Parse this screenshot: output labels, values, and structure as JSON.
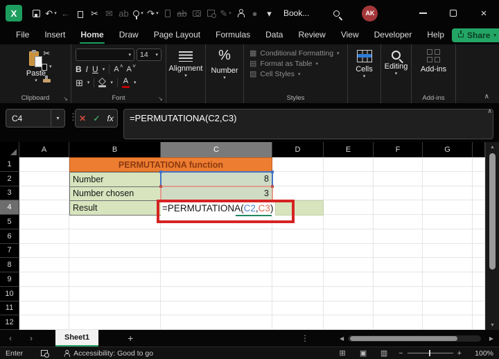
{
  "title_bar": {
    "workbook_title": "Book...",
    "avatar_initials": "AK",
    "qat_icons": [
      {
        "name": "save-icon",
        "kind": "save"
      },
      {
        "name": "undo-icon",
        "kind": "char",
        "char": "↶",
        "dropdown": true
      },
      {
        "name": "back-arrow-icon",
        "kind": "char",
        "char": "←",
        "dim": true
      },
      {
        "name": "copy-icon",
        "kind": "copy"
      },
      {
        "name": "cut-icon",
        "kind": "char",
        "char": "✂"
      },
      {
        "name": "mail-icon",
        "kind": "char",
        "char": "✉",
        "dim": true
      },
      {
        "name": "find-replace-icon",
        "kind": "char",
        "char": "ab",
        "dim": true
      },
      {
        "name": "touch-mode-icon",
        "kind": "touch",
        "dropdown": true
      },
      {
        "name": "redo-icon",
        "kind": "char",
        "char": "↷",
        "dropdown": true
      },
      {
        "name": "new-file-icon",
        "kind": "page",
        "dim": true
      },
      {
        "name": "strikethrough-icon",
        "kind": "char",
        "char": "ab",
        "dim": true,
        "strike": true
      },
      {
        "name": "camera-icon",
        "kind": "camera",
        "dim": true
      },
      {
        "name": "sheet-lookup-icon",
        "kind": "lookup",
        "dim": true
      },
      {
        "name": "draw-export-icon",
        "kind": "char",
        "char": "✎",
        "dim": true,
        "dropdown": true
      },
      {
        "name": "person-search-icon",
        "kind": "person"
      },
      {
        "name": "record-icon",
        "kind": "char",
        "char": "●",
        "dim": true
      },
      {
        "name": "qat-overflow-icon",
        "kind": "char",
        "char": "▾"
      }
    ],
    "window": {
      "minimize": "",
      "maximize": "",
      "close": "×"
    }
  },
  "ribbon": {
    "tabs": [
      "File",
      "Insert",
      "Home",
      "Draw",
      "Page Layout",
      "Formulas",
      "Data",
      "Review",
      "View",
      "Developer",
      "Help"
    ],
    "share_label": "Share",
    "clipboard": {
      "paste_label": "Paste",
      "group_label": "Clipboard"
    },
    "font": {
      "size_value": "14",
      "bold": "B",
      "italic": "I",
      "underline": "U",
      "grow": "A",
      "shrink": "A",
      "group_label": "Font"
    },
    "alignment": {
      "label": "Alignment"
    },
    "number": {
      "label": "Number",
      "percent": "%"
    },
    "styles": {
      "items": [
        "Conditional Formatting",
        "Format as Table",
        "Cell Styles"
      ],
      "group_label": "Styles"
    },
    "cells": {
      "label": "Cells"
    },
    "editing": {
      "label": "Editing"
    },
    "addins": {
      "button_label": "Add-ins",
      "group_label": "Add-ins"
    }
  },
  "formula_bar": {
    "name_box_value": "C4",
    "cancel": "✕",
    "enter": "✓",
    "fx": "fx",
    "formula": "=PERMUTATIONA(C2,C3)"
  },
  "sheet": {
    "columns": [
      "A",
      "B",
      "C",
      "D",
      "E",
      "F",
      "G"
    ],
    "rows": [
      "1",
      "2",
      "3",
      "4",
      "5",
      "6",
      "7",
      "8",
      "9",
      "10",
      "11",
      "12"
    ],
    "selected_column": "C",
    "selected_row": "4",
    "cells": {
      "title": "PERMUTATIONA function",
      "b2_label": "Number",
      "c2_value": "8",
      "b3_label": "Number chosen",
      "c3_value": "3",
      "b4_label": "Result",
      "c4_formula": {
        "prefix": "=PERMUTATIONA(",
        "ref1": "C2",
        "comma": ",",
        "ref2": "C3",
        "suffix": ")"
      }
    }
  },
  "sheet_tabs": {
    "active_sheet": "Sheet1",
    "add_sheet": "+"
  },
  "status_bar": {
    "mode": "Enter",
    "accessibility": "Accessibility: Good to go",
    "zoom_level": "100%"
  },
  "glyphs": {
    "dropdown": "▾",
    "collapse": "∧",
    "dots_v": "⋮",
    "prev": "‹",
    "next": "›",
    "scroll_left": "◀",
    "scroll_right": "▶",
    "scroll_up": "▲",
    "scroll_down": "▼",
    "minus": "−",
    "plus": "+",
    "borders": "⊞",
    "cf_icon": "▦",
    "table_icon": "▤",
    "cellstyles_icon": "▨",
    "view_normal": "⊞",
    "view_layout": "▣",
    "view_break": "▥",
    "launcher": "↘"
  },
  "colors": {
    "accent_green": "#1EA15F",
    "share_green": "#23A566",
    "title_orange": "#ED7D31",
    "title_text": "#8C3A10",
    "cell_green": "#D7E4BE",
    "ref_blue": "#4472C4",
    "ref_red": "#E0694F",
    "annotation_red": "#D62322",
    "avatar_red": "#A4373A"
  }
}
